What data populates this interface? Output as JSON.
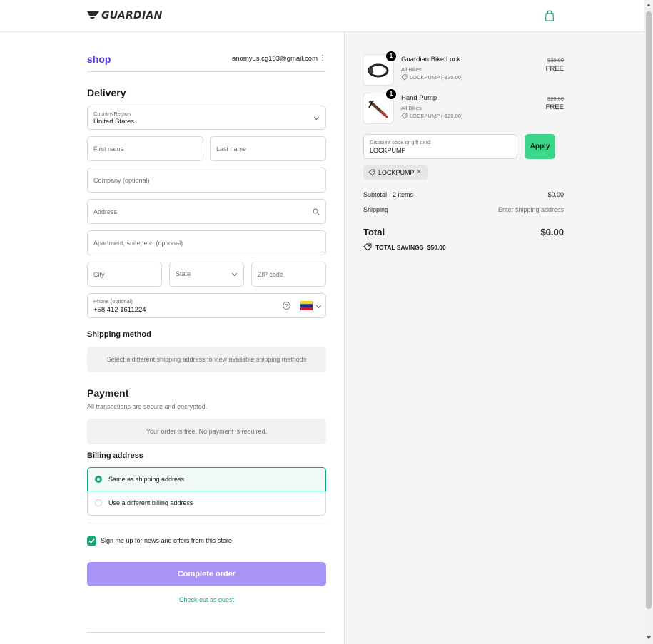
{
  "header": {
    "brand": "GUARDIAN",
    "cart_icon": "shopping-bag-icon"
  },
  "account": {
    "shop_label": "shop",
    "email": "anomyus.cg103@gmail.com",
    "menu_icon": "kebab-icon"
  },
  "delivery": {
    "title": "Delivery",
    "country_label": "Country/Region",
    "country_value": "United States",
    "first_name": "First name",
    "last_name": "Last name",
    "company": "Company (optional)",
    "address": "Address",
    "apartment": "Apartment, suite, etc. (optional)",
    "city": "City",
    "state": "State",
    "zip": "ZIP code",
    "phone_label": "Phone (optional)",
    "phone_value": "+58 412 1611224"
  },
  "shipping": {
    "title": "Shipping method",
    "message": "Select a different shipping address to view available shipping methods"
  },
  "payment": {
    "title": "Payment",
    "subtitle": "All transactions are secure and encrypted.",
    "message": "Your order is free. No payment is required."
  },
  "billing": {
    "title": "Billing address",
    "options": [
      "Same as shipping address",
      "Use a different billing address"
    ],
    "selected": 0
  },
  "newsletter": {
    "label": "Sign me up for news and offers from this store",
    "checked": true
  },
  "actions": {
    "complete": "Complete order",
    "guest": "Check out as guest"
  },
  "cart": {
    "items": [
      {
        "name": "Guardian Bike Lock",
        "variant": "All Bikes",
        "quantity": "1",
        "discount": "LOCKPUMP (-$30.00)",
        "original_price": "$30.00",
        "price": "FREE"
      },
      {
        "name": "Hand Pump",
        "variant": "All Bikes",
        "quantity": "1",
        "discount": "LOCKPUMP (-$20.00)",
        "original_price": "$20.00",
        "price": "FREE"
      }
    ],
    "discount_label": "Discount code or gift card",
    "discount_value": "LOCKPUMP",
    "apply": "Apply",
    "applied_code": "LOCKPUMP",
    "subtotal_label": "Subtotal · 2 items",
    "subtotal_value": "$0.00",
    "shipping_label": "Shipping",
    "shipping_value": "Enter shipping address",
    "total_label": "Total",
    "currency": "USD",
    "total_value": "$0.00",
    "savings_label": "TOTAL SAVINGS",
    "savings_value": "$50.00"
  },
  "colors": {
    "accent_green": "#1aa672",
    "apply_green": "#3bd68a",
    "complete_purple": "#a794f5",
    "shop_purple": "#5a31f4"
  }
}
